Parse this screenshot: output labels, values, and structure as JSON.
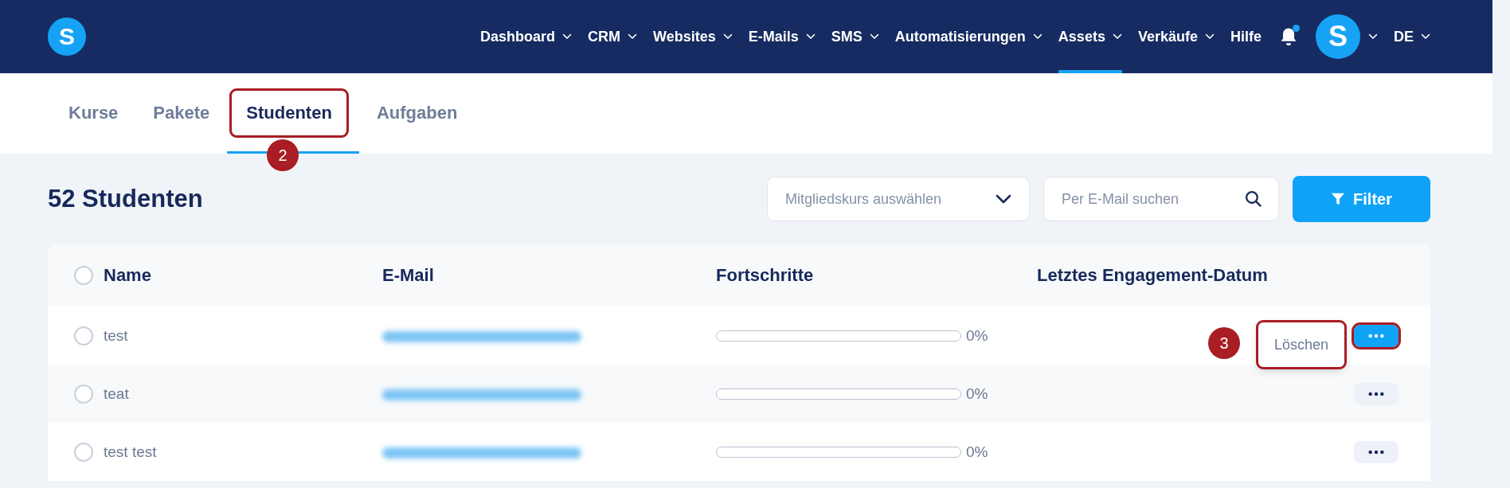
{
  "nav": {
    "logo": "S",
    "items": [
      {
        "label": "Dashboard",
        "dropdown": true,
        "selected": false
      },
      {
        "label": "CRM",
        "dropdown": true,
        "selected": false
      },
      {
        "label": "Websites",
        "dropdown": true,
        "selected": false
      },
      {
        "label": "E-Mails",
        "dropdown": true,
        "selected": false
      },
      {
        "label": "SMS",
        "dropdown": true,
        "selected": false
      },
      {
        "label": "Automatisierungen",
        "dropdown": true,
        "selected": false
      },
      {
        "label": "Assets",
        "dropdown": true,
        "selected": true
      },
      {
        "label": "Verkäufe",
        "dropdown": true,
        "selected": false
      },
      {
        "label": "Hilfe",
        "dropdown": false,
        "selected": false
      }
    ],
    "notifications": {
      "unread": true
    },
    "avatar": {
      "initial": "S"
    },
    "language": {
      "label": "DE"
    }
  },
  "tabs": [
    {
      "label": "Kurse",
      "selected": false,
      "highlighted": false
    },
    {
      "label": "Pakete",
      "selected": false,
      "highlighted": false
    },
    {
      "label": "Studenten",
      "selected": true,
      "highlighted": true,
      "step": "2"
    },
    {
      "label": "Aufgaben",
      "selected": false,
      "highlighted": false
    }
  ],
  "heading": "52 Studenten",
  "course_select": {
    "placeholder": "Mitgliedskurs auswählen"
  },
  "search": {
    "placeholder": "Per E-Mail suchen"
  },
  "filter_button": {
    "label": "Filter"
  },
  "table": {
    "all_checked": false,
    "columns": [
      "Name",
      "E-Mail",
      "Fortschritte",
      "Letztes Engagement-Datum"
    ],
    "rows": [
      {
        "name": "test",
        "email_blurred": true,
        "level": 0,
        "progress": "0%",
        "checked": false,
        "menu_open": true,
        "menu_highlighted": true,
        "step": "3",
        "menu_items": [
          {
            "label": "Löschen",
            "highlighted": true
          }
        ]
      },
      {
        "name": "teat",
        "email_blurred": true,
        "level": 0,
        "progress": "0%",
        "checked": false,
        "menu_open": false,
        "menu_highlighted": false
      },
      {
        "name": "test test",
        "email_blurred": true,
        "level": 0,
        "progress": "0%",
        "checked": false,
        "menu_open": false,
        "menu_highlighted": false
      }
    ]
  }
}
